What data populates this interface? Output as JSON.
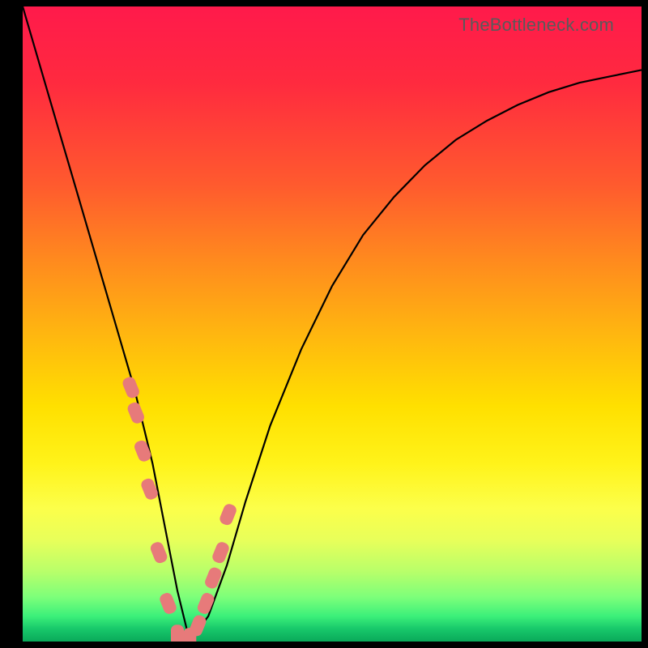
{
  "watermark": "TheBottleneck.com",
  "colors": {
    "frame": "#000000",
    "curve": "#000000",
    "marker": "#e77a7a",
    "gradient_top": "#ff1a4b",
    "gradient_bottom": "#0aa95a"
  },
  "chart_data": {
    "type": "line",
    "title": "",
    "xlabel": "",
    "ylabel": "",
    "xlim": [
      0,
      100
    ],
    "ylim": [
      0,
      100
    ],
    "grid": false,
    "legend_position": "none",
    "annotations": [
      "TheBottleneck.com"
    ],
    "series": [
      {
        "name": "bottleneck-curve",
        "x": [
          0,
          3,
          6,
          9,
          12,
          15,
          18,
          21,
          23,
          25,
          27,
          30,
          33,
          36,
          40,
          45,
          50,
          55,
          60,
          65,
          70,
          75,
          80,
          85,
          90,
          95,
          100
        ],
        "y": [
          100,
          90,
          80,
          70,
          60,
          50,
          40,
          28,
          18,
          8,
          0,
          4,
          12,
          22,
          34,
          46,
          56,
          64,
          70,
          75,
          79,
          82,
          84.5,
          86.5,
          88,
          89,
          90
        ]
      }
    ],
    "markers": {
      "name": "highlighted-points",
      "x": [
        17.5,
        18.3,
        19.4,
        20.5,
        22.0,
        23.5,
        25.0,
        26.0,
        27.0,
        28.3,
        29.6,
        30.8,
        32.0,
        33.2
      ],
      "y": [
        40,
        36,
        30,
        24,
        14,
        6,
        1,
        0,
        0.5,
        2.5,
        6,
        10,
        14,
        20
      ]
    }
  }
}
